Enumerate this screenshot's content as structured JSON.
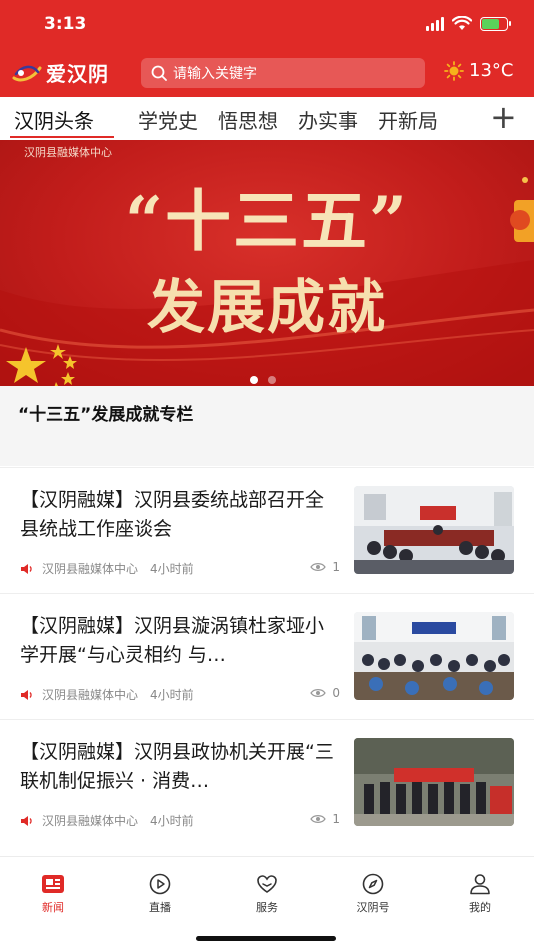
{
  "status_bar": {
    "time": "3:13"
  },
  "header": {
    "logo_text": "爱汉阴",
    "search_placeholder": "请输入关键字",
    "weather_temp": "13°C"
  },
  "tabs": [
    {
      "label": "汉阴头条",
      "active": true
    },
    {
      "label": "学党史"
    },
    {
      "label": "悟思想"
    },
    {
      "label": "办实事"
    },
    {
      "label": "开新局"
    }
  ],
  "banner": {
    "source": "汉阴县融媒体中心",
    "line1": "“十三五”",
    "line2": "发展成就",
    "caption": "“十三五”发展成就专栏",
    "slide_count": 2,
    "active_slide": 1
  },
  "news": [
    {
      "title": "【汉阴融媒】汉阴县委统战部召开全县统战工作座谈会",
      "source": "汉阴县融媒体中心",
      "time": "4小时前",
      "views": "1"
    },
    {
      "title": "【汉阴融媒】汉阴县漩涡镇杜家垭小学开展“与心灵相约 与…",
      "source": "汉阴县融媒体中心",
      "time": "4小时前",
      "views": "0"
    },
    {
      "title": "【汉阴融媒】汉阴县政协机关开展“三联机制促振兴 · 消费…",
      "source": "汉阴县融媒体中心",
      "time": "4小时前",
      "views": "1"
    }
  ],
  "bottom_nav": [
    {
      "label": "新闻",
      "icon": "news-icon",
      "active": true
    },
    {
      "label": "直播",
      "icon": "live-icon"
    },
    {
      "label": "服务",
      "icon": "service-icon"
    },
    {
      "label": "汉阴号",
      "icon": "compass-icon"
    },
    {
      "label": "我的",
      "icon": "profile-icon"
    }
  ],
  "colors": {
    "brand_red": "#e02a27",
    "banner_gold": "#f7e4b8"
  }
}
